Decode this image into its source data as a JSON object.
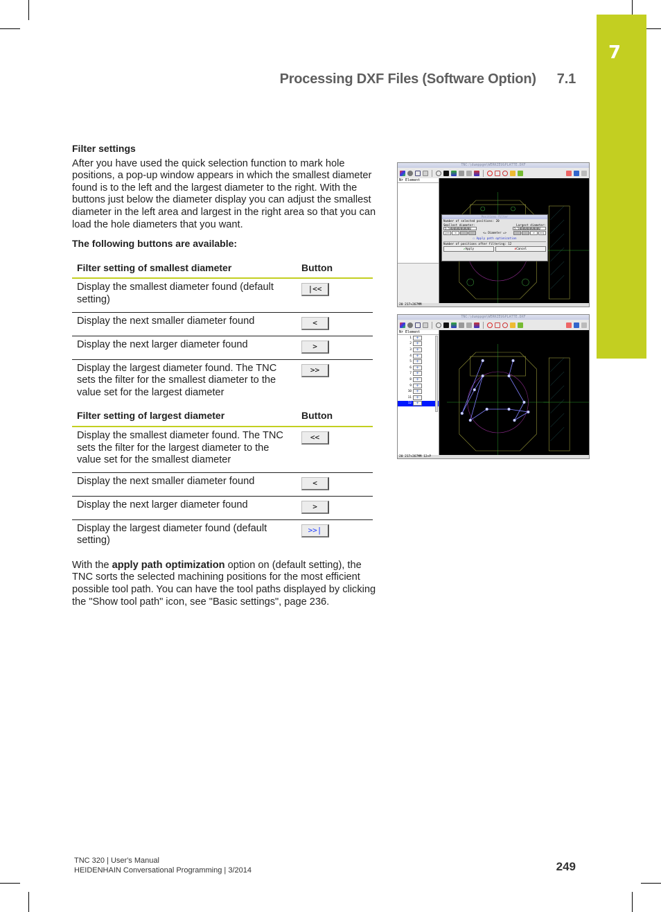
{
  "header": {
    "title": "Processing DXF Files (Software Option)",
    "section": "7.1",
    "chapter": "7",
    "accent_color": "#c3cf21"
  },
  "filter_settings": {
    "heading": "Filter settings",
    "intro": "After you have used the quick selection function to mark hole positions, a pop-up window appears in which the smallest diameter found is to the left and the largest diameter to the right. With the buttons just below the diameter display you can adjust the smallest diameter in the left area and largest in the right area so that you can load the hole diameters that you want.",
    "buttons_heading": "The following buttons are available:"
  },
  "table_smallest": {
    "headers": [
      "Filter setting of smallest diameter",
      "Button"
    ],
    "rows": [
      {
        "description": "Display the smallest diameter found (default setting)",
        "button": "|<<",
        "highlight": false
      },
      {
        "description": "Display the next smaller diameter found",
        "button": "<",
        "highlight": false
      },
      {
        "description": "Display the next larger diameter found",
        "button": ">",
        "highlight": false
      },
      {
        "description": "Display the largest diameter found. The TNC sets the filter for the smallest diameter to the value set for the largest diameter",
        "button": ">>",
        "highlight": false
      }
    ]
  },
  "table_largest": {
    "headers": [
      "Filter setting of largest diameter",
      "Button"
    ],
    "rows": [
      {
        "description": "Display the smallest diameter found. The TNC sets the filter for the largest diameter to the value set for the smallest diameter",
        "button": "<<",
        "highlight": false
      },
      {
        "description": "Display the next smaller diameter found",
        "button": "<",
        "highlight": false
      },
      {
        "description": "Display the next larger diameter found",
        "button": ">",
        "highlight": false
      },
      {
        "description": "Display the largest diameter found (default setting)",
        "button": ">>|",
        "highlight": true
      }
    ]
  },
  "closing": {
    "prefix": "With the ",
    "bold": "apply path optimization",
    "suffix": " option on (default setting), the TNC sorts the selected machining positions for the most efficient possible tool path. You can have the tool paths displayed by clicking the \"Show tool path\" icon, see \"Basic settings\", page 236."
  },
  "screenshot1": {
    "window_title": "TNC:\\dumppgm\\WERKZEUGPLATTE.DXF",
    "list_headers": [
      "Nr",
      "Element"
    ],
    "status": "20   217+267MM",
    "dialog": {
      "title": "Positions filter",
      "selected_positions": "Number of selected positions: 20",
      "smallest_label": "Smallest diameter:",
      "largest_label": "Largest diameter:",
      "smallest_value": "5.5000000000000",
      "largest_value": "5.5000000000000",
      "left_buttons": [
        "|<<",
        "<",
        ">",
        ">>"
      ],
      "center_label": "<= Diameter =>",
      "right_buttons": [
        "<<",
        "<",
        ">",
        ">>|"
      ],
      "option_label": "Apply path optimization",
      "after_filtering": "Number of positions after filtering: 12",
      "apply_label": "Apply",
      "cancel_label": "Cancel"
    }
  },
  "screenshot2": {
    "window_title": "TNC:\\dumppgm\\WERKZEUGPLATTE.DXF",
    "list_headers": [
      "Nr",
      "Element"
    ],
    "list_items": [
      "1",
      "2",
      "3",
      "4",
      "5",
      "6",
      "7",
      "8",
      "9",
      "10",
      "11",
      "12"
    ],
    "selected_item": "12",
    "status": "20   217+267MM   12+P"
  },
  "footer": {
    "line1": "TNC 320 | User's Manual",
    "line2": "HEIDENHAIN Conversational Programming | 3/2014",
    "page": "249"
  }
}
